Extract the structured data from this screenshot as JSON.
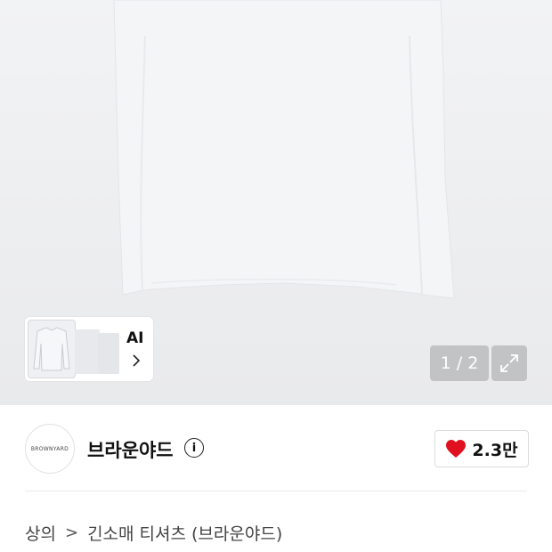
{
  "gallery": {
    "ai_label": "AI",
    "counter": "1 / 2",
    "icons": {
      "ai_chevron": "chevron-right-icon",
      "expand": "expand-icon"
    }
  },
  "brand": {
    "logo_text": "BROWNYARD",
    "name": "브라운야드",
    "info_icon": "info-icon"
  },
  "likes": {
    "count": "2.3만",
    "icon": "heart-icon",
    "color": "#e0111f"
  },
  "breadcrumb": {
    "category": "상의",
    "separator": ">",
    "product": "긴소매 티셔츠 (브라운야드)"
  }
}
